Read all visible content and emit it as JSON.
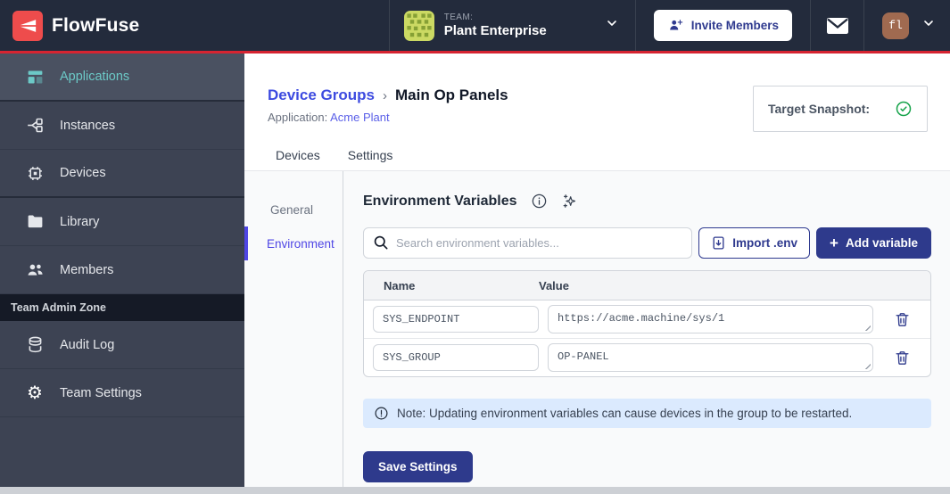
{
  "colors": {
    "accent_red": "#d62431",
    "brand_red": "#ee4c4c",
    "navy": "#2e3a8c",
    "indigo": "#4f46e5",
    "teal": "#6cc9c7",
    "note_bg": "#dbeafe",
    "success_green": "#16a34a",
    "header_bg": "#232b3c",
    "sidebar_bg": "#3d4353"
  },
  "header": {
    "logo_text": "FlowFuse",
    "team_label": "TEAM:",
    "team_name": "Plant Enterprise",
    "invite_button_label": "Invite Members",
    "user_initials": "fl"
  },
  "sidebar": {
    "items": [
      {
        "label": "Applications",
        "icon": "applications-icon",
        "active": true
      },
      {
        "label": "Instances",
        "icon": "instances-icon"
      },
      {
        "label": "Devices",
        "icon": "chip-icon"
      },
      {
        "label": "Library",
        "icon": "folder-icon"
      },
      {
        "label": "Members",
        "icon": "users-icon"
      }
    ],
    "admin_zone_label": "Team Admin Zone",
    "admin_items": [
      {
        "label": "Audit Log",
        "icon": "database-icon"
      },
      {
        "label": "Team Settings",
        "icon": "gear-icon"
      }
    ]
  },
  "page": {
    "breadcrumb": {
      "parent": "Device Groups",
      "separator": "›",
      "current": "Main Op Panels"
    },
    "application_label": "Application:",
    "application_link": "Acme Plant",
    "target_snapshot_label": "Target Snapshot:",
    "tabs": [
      {
        "label": "Devices"
      },
      {
        "label": "Settings"
      }
    ],
    "subnav": [
      {
        "label": "General"
      },
      {
        "label": "Environment",
        "active": true
      }
    ],
    "settings": {
      "heading": "Environment Variables",
      "search_placeholder": "Search environment variables...",
      "import_button_label": "Import .env",
      "add_button_plus": "+",
      "add_button_label": "Add variable",
      "table": {
        "headers": [
          "Name",
          "Value"
        ],
        "rows": [
          {
            "name": "SYS_ENDPOINT",
            "value": "https://acme.machine/sys/1"
          },
          {
            "name": "SYS_GROUP",
            "value": "OP-PANEL"
          }
        ]
      },
      "note": "Note: Updating environment variables can cause devices in the group to be restarted.",
      "save_button_label": "Save Settings"
    }
  }
}
